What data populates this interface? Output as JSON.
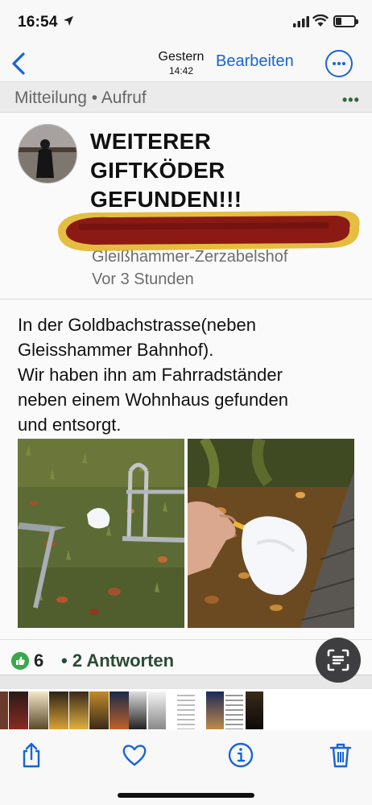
{
  "status_bar": {
    "time": "16:54",
    "battery_level": 0.3
  },
  "nav": {
    "date": "Gestern",
    "time": "14:42",
    "edit_label": "Bearbeiten"
  },
  "post": {
    "category": "Mitteilung • Aufruf",
    "title_lines": [
      "WEITERER",
      "GIFTKÖDER",
      "GEFUNDEN!!!"
    ],
    "neighborhood": "Gleißhammer-Zerzabelshof",
    "time_ago": "Vor 3 Stunden",
    "body_lines": [
      "In der Goldbachstrasse(neben",
      "Gleisshammer Bahnhof).",
      "Wir haben ihn am Fahrradständer",
      "neben einem Wohnhaus gefunden",
      "und entsorgt."
    ],
    "likes": "6",
    "replies": "• 2 Antworten"
  },
  "colors": {
    "accent": "#1764d8",
    "like": "#3aa84a",
    "redaction": "#8b1a14"
  }
}
